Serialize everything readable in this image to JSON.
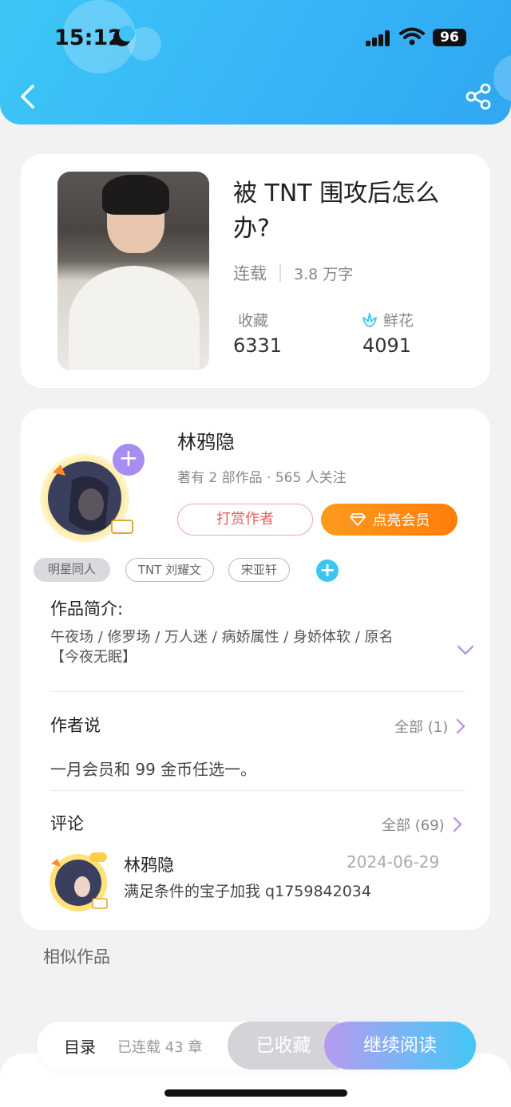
{
  "status": {
    "time": "15:12",
    "battery": "96"
  },
  "book": {
    "title": "被 TNT 围攻后怎么办?",
    "status": "连载",
    "words": "3.8 万字",
    "collect_label": "收藏",
    "collect_count": "6331",
    "flower_label": "鲜花",
    "flower_count": "4091"
  },
  "author": {
    "name": "林鸦隐",
    "info": "著有 2 部作品 · 565 人关注",
    "tip_label": "打赏作者",
    "vip_label": "点亮会员"
  },
  "tags": [
    "明星同人",
    "TNT 刘耀文",
    "宋亚轩"
  ],
  "intro": {
    "title": "作品简介:",
    "text": "午夜场 / 修罗场 / 万人迷 / 病娇属性 / 身娇体软 / 原名【今夜无眠】"
  },
  "author_says": {
    "title": "作者说",
    "more": "全部 (1)",
    "text": "一月会员和 99 金币任选一。"
  },
  "comments": {
    "title": "评论",
    "more": "全部 (69)",
    "item": {
      "name": "林鸦隐",
      "date": "2024-06-29",
      "text": "满足条件的宝子加我 q1759842034"
    }
  },
  "similar_title": "相似作品",
  "bottom": {
    "toc": "目录",
    "toc_count": "已连载 43 章",
    "collected": "已收藏",
    "continue": "继续阅读"
  },
  "colors": {
    "header": "#38b6f8",
    "accent_orange": "#ff8a14",
    "accent_cyan": "#3cc5ef",
    "accent_purple": "#b79af0"
  }
}
